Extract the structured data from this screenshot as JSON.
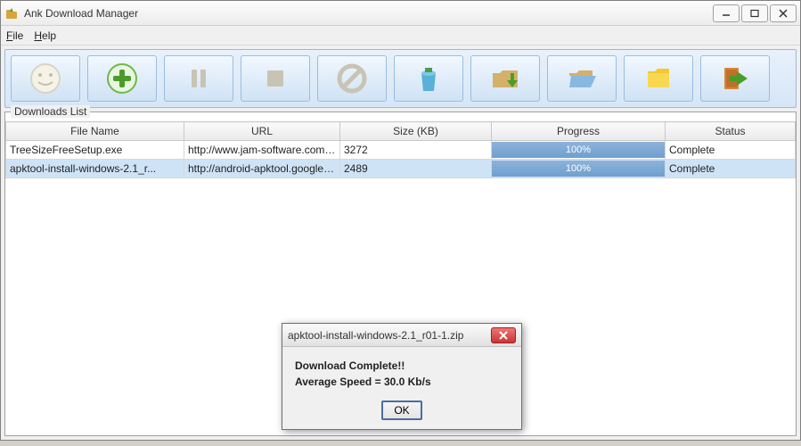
{
  "app": {
    "title": "Ank Download Manager"
  },
  "menu": {
    "file": "File",
    "help": "Help"
  },
  "toolbar": {
    "smiley": "smiley-icon",
    "add": "add-icon",
    "pause": "pause-icon",
    "stop": "stop-icon",
    "cancel": "cancel-icon",
    "trash": "trash-icon",
    "folder_down": "folder-down-icon",
    "open_folder": "open-folder-icon",
    "folder": "folder-icon",
    "exit": "exit-icon"
  },
  "list": {
    "legend": "Downloads List",
    "columns": {
      "filename": "File Name",
      "url": "URL",
      "size": "Size (KB)",
      "progress": "Progress",
      "status": "Status"
    },
    "rows": [
      {
        "filename": "TreeSizeFreeSetup.exe",
        "url": "http://www.jam-software.com/...",
        "size": "3272",
        "progress": "100%",
        "status": "Complete",
        "selected": false
      },
      {
        "filename": "apktool-install-windows-2.1_r...",
        "url": "http://android-apktool.googlec...",
        "size": "2489",
        "progress": "100%",
        "status": "Complete",
        "selected": true
      }
    ]
  },
  "dialog": {
    "title": "apktool-install-windows-2.1_r01-1.zip",
    "line1": "Download Complete!!",
    "line2": "Average Speed = 30.0 Kb/s",
    "ok": "OK"
  }
}
